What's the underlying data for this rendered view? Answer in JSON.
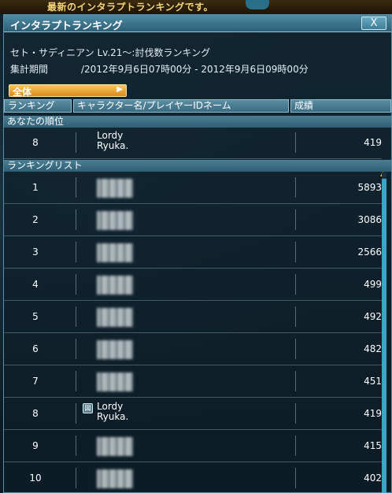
{
  "top_message": "最新のインタラプトランキングです。",
  "window": {
    "title": "インタラプトランキング",
    "close_label": "X"
  },
  "info": {
    "ranking_name": "セト・サディニアン Lv.21～:討伐数ランキング",
    "period_label": "集計期間",
    "period_value": "/2012年9月6日07時00分 - 2012年9月6日09時00分"
  },
  "filter": {
    "selected": "全体"
  },
  "columns": {
    "rank": "ランキング",
    "name": "キャラクター名/プレイヤーIDネーム",
    "score": "成績"
  },
  "my_rank": {
    "section": "あなたの順位",
    "rank": "8",
    "name_line1": "Lordy",
    "name_line2": "Ryuka.",
    "score": "419"
  },
  "list": {
    "section": "ランキングリスト",
    "rows": [
      {
        "rank": "1",
        "score": "5893"
      },
      {
        "rank": "2",
        "score": "3086"
      },
      {
        "rank": "3",
        "score": "2566"
      },
      {
        "rank": "4",
        "score": "499"
      },
      {
        "rank": "5",
        "score": "492"
      },
      {
        "rank": "6",
        "score": "482"
      },
      {
        "rank": "7",
        "score": "451"
      },
      {
        "rank": "8",
        "score": "419",
        "name_line1": "Lordy",
        "name_line2": "Ryuka.",
        "badge": "図"
      },
      {
        "rank": "9",
        "score": "415"
      },
      {
        "rank": "10",
        "score": "402"
      }
    ]
  }
}
